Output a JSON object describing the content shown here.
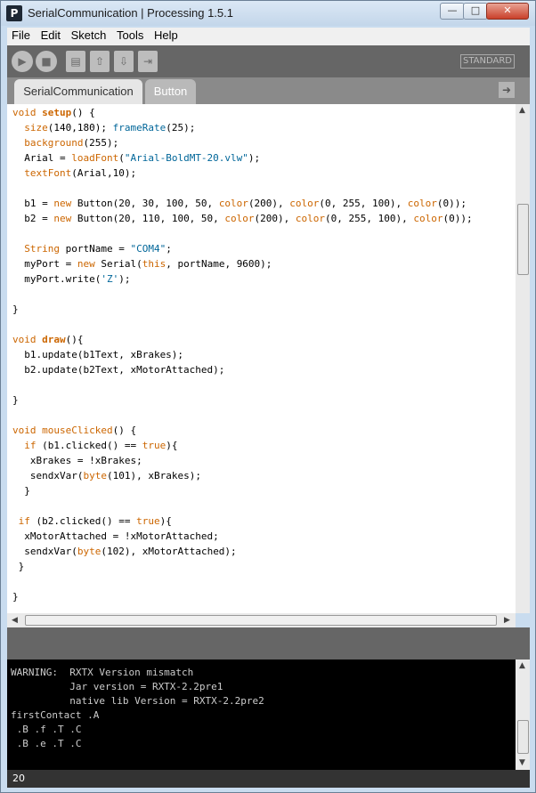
{
  "window": {
    "title": "SerialCommunication | Processing 1.5.1",
    "app_icon": "P",
    "min": "—",
    "max": "□",
    "close": "✕"
  },
  "menu": [
    "File",
    "Edit",
    "Sketch",
    "Tools",
    "Help"
  ],
  "toolbar": {
    "mode": "STANDARD",
    "run": "▶",
    "stop": "■",
    "new": "▤",
    "open": "⇧",
    "save": "⇩",
    "export": "⇥"
  },
  "tabs": {
    "active": "SerialCommunication",
    "other": "Button",
    "menu_arrow": "➜"
  },
  "code_lines": [
    "void setup() {",
    "  size(140,180); frameRate(25);",
    "  background(255);",
    "  Arial = loadFont(\"Arial-BoldMT-20.vlw\");",
    "  textFont(Arial,10);",
    "",
    "  b1 = new Button(20, 30, 100, 50, color(200), color(0, 255, 100), color(0));",
    "  b2 = new Button(20, 110, 100, 50, color(200), color(0, 255, 100), color(0));",
    "",
    "  String portName = \"COM4\";",
    "  myPort = new Serial(this, portName, 9600);",
    "  myPort.write('Z');",
    "",
    "}",
    "",
    "void draw(){",
    "  b1.update(b1Text, xBrakes);",
    "  b2.update(b2Text, xMotorAttached);",
    "",
    "}",
    "",
    "void mouseClicked() {",
    "  if (b1.clicked() == true){",
    "   xBrakes = !xBrakes;",
    "   sendxVar(byte(101), xBrakes);",
    "  }",
    "",
    " if (b2.clicked() == true){",
    "  xMotorAttached = !xMotorAttached;",
    "  sendxVar(byte(102), xMotorAttached);",
    " }",
    "",
    "}"
  ],
  "console_lines": [
    "WARNING:  RXTX Version mismatch",
    "          Jar version = RXTX-2.2pre1",
    "          native lib Version = RXTX-2.2pre2",
    "firstContact .A",
    " .B .f .T .C",
    " .B .e .T .C"
  ],
  "status": {
    "line_number": "20"
  }
}
